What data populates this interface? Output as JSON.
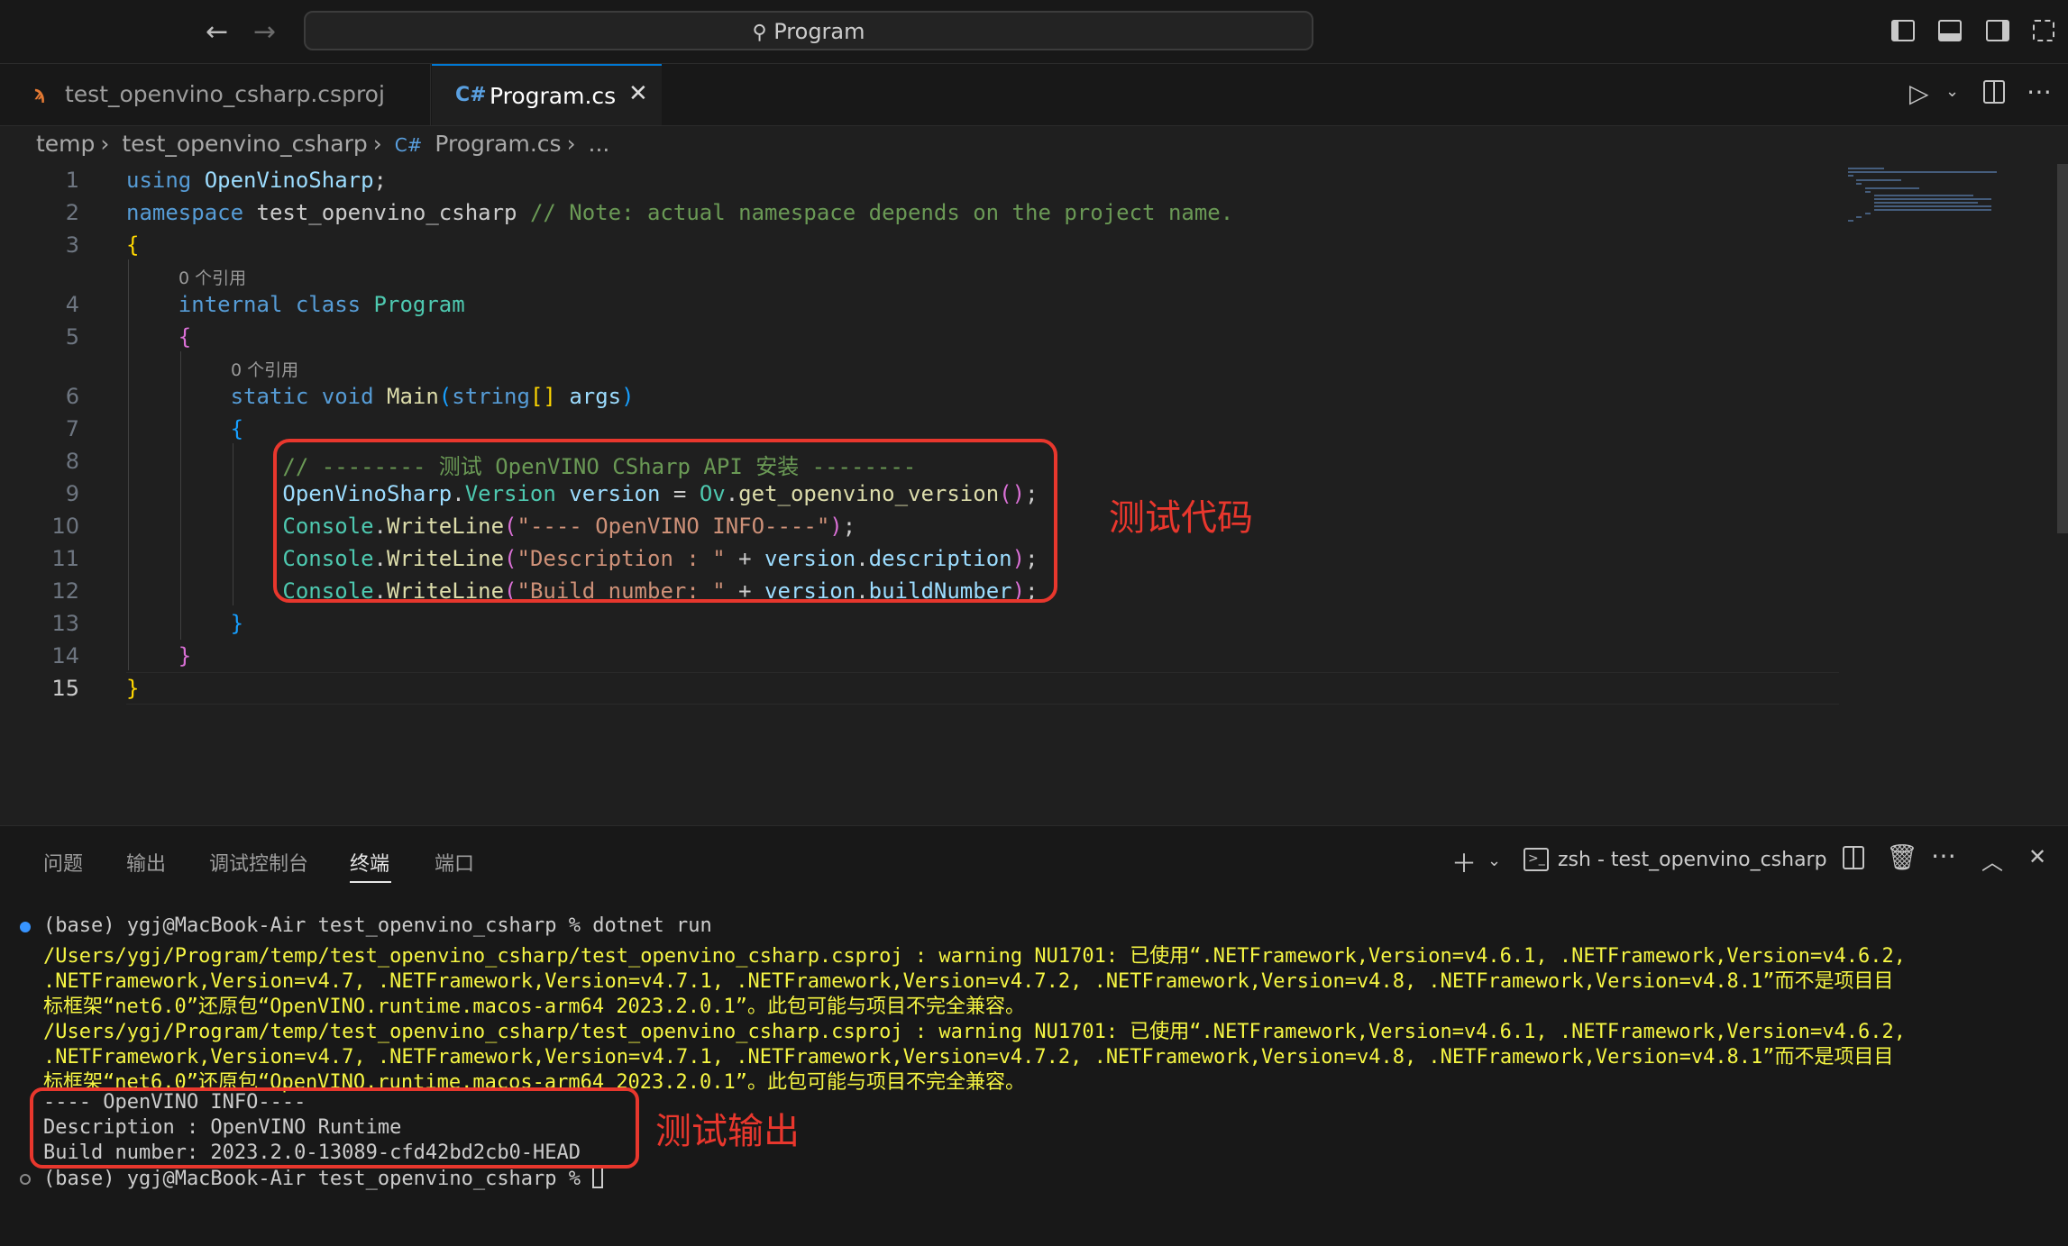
{
  "titlebar": {
    "search_text": "Program"
  },
  "tabs": [
    {
      "label": "test_openvino_csharp.csproj",
      "icon": "rss-icon"
    },
    {
      "label": "Program.cs",
      "icon": "csharp-icon",
      "active": true
    }
  ],
  "breadcrumb": [
    "temp",
    "test_openvino_csharp",
    "Program.cs",
    "..."
  ],
  "editor": {
    "line_numbers": [
      "1",
      "2",
      "3",
      "4",
      "5",
      "6",
      "7",
      "8",
      "9",
      "10",
      "11",
      "12",
      "13",
      "14",
      "15"
    ],
    "active_line": "15",
    "codelens_text": "0 个引用",
    "code": {
      "l1": [
        "using",
        "OpenVinoSharp",
        ";"
      ],
      "l2": [
        "namespace",
        "test_openvino_csharp",
        "// Note: actual namespace depends on the project name."
      ],
      "l3": [
        "{"
      ],
      "l4": [
        "internal",
        "class",
        "Program"
      ],
      "l5": [
        "{"
      ],
      "l6": [
        "static",
        "void",
        "Main",
        "(",
        "string",
        "[]",
        "args",
        ")"
      ],
      "l7": [
        "{"
      ],
      "l8": [
        "// -------- 测试 OpenVINO CSharp API 安装 --------"
      ],
      "l9": [
        "OpenVinoSharp",
        ".",
        "Version",
        "version",
        "=",
        "Ov",
        ".",
        "get_openvino_version",
        "()",
        ";"
      ],
      "l10": [
        "Console",
        ".",
        "WriteLine",
        "(",
        "\"---- OpenVINO INFO----\"",
        ")",
        ";"
      ],
      "l11": [
        "Console",
        ".",
        "WriteLine",
        "(",
        "\"Description : \"",
        "+",
        "version",
        ".",
        "description",
        ")",
        ";"
      ],
      "l12": [
        "Console",
        ".",
        "WriteLine",
        "(",
        "\"Build number: \"",
        "+",
        "version",
        ".",
        "buildNumber",
        ")",
        ";"
      ],
      "l13": [
        "}"
      ],
      "l14": [
        "}"
      ],
      "l15": [
        "}"
      ]
    },
    "annotation": "测试代码"
  },
  "panel": {
    "tabs": [
      "问题",
      "输出",
      "调试控制台",
      "终端",
      "端口"
    ],
    "active_tab": "终端",
    "terminal_name": "zsh - test_openvino_csharp",
    "lines": [
      "(base) ygj@MacBook-Air test_openvino_csharp % dotnet run",
      "/Users/ygj/Program/temp/test_openvino_csharp/test_openvino_csharp.csproj : warning NU1701: 已使用“.NETFramework,Version=v4.6.1, .NETFramework,Version=v4.6.2,",
      ".NETFramework,Version=v4.7, .NETFramework,Version=v4.7.1, .NETFramework,Version=v4.7.2, .NETFramework,Version=v4.8, .NETFramework,Version=v4.8.1”而不是项目目",
      "标框架“net6.0”还原包“OpenVINO.runtime.macos-arm64 2023.2.0.1”。此包可能与项目不完全兼容。",
      "/Users/ygj/Program/temp/test_openvino_csharp/test_openvino_csharp.csproj : warning NU1701: 已使用“.NETFramework,Version=v4.6.1, .NETFramework,Version=v4.6.2,",
      ".NETFramework,Version=v4.7, .NETFramework,Version=v4.7.1, .NETFramework,Version=v4.7.2, .NETFramework,Version=v4.8, .NETFramework,Version=v4.8.1”而不是项目目",
      "标框架“net6.0”还原包“OpenVINO.runtime.macos-arm64 2023.2.0.1”。此包可能与项目不完全兼容。",
      "---- OpenVINO INFO----",
      "Description : OpenVINO Runtime",
      "Build number: 2023.2.0-13089-cfd42bd2cb0-HEAD",
      "(base) ygj@MacBook-Air test_openvino_csharp % "
    ],
    "annotation": "测试输出"
  },
  "colors": {
    "accent": "#0078d4",
    "annotation_red": "#e8372d",
    "warning_yellow": "#f5f543"
  }
}
